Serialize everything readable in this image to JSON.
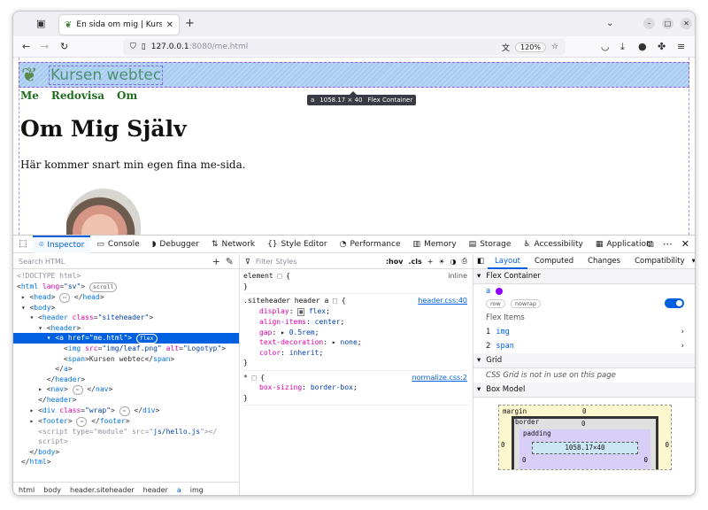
{
  "browser": {
    "tab_title": "En sida om mig | Kursen webtec",
    "url_host": "127.0.0.1",
    "url_rest": ":8080/me.html",
    "zoom": "120%"
  },
  "page": {
    "brand": "Kursen webtec",
    "nav": [
      "Me",
      "Redovisa",
      "Om"
    ],
    "heading": "Om Mig Själv",
    "lead": "Här kommer snart min egen fina me-sida.",
    "tooltip_tag": "a",
    "tooltip_size": "1058.17 × 40",
    "tooltip_kind": "Flex Container"
  },
  "devtools": {
    "tabs": [
      {
        "icon": "⌾",
        "label": "Inspector"
      },
      {
        "icon": "▭",
        "label": "Console"
      },
      {
        "icon": "◗",
        "label": "Debugger"
      },
      {
        "icon": "⇅",
        "label": "Network"
      },
      {
        "icon": "{}",
        "label": "Style Editor"
      },
      {
        "icon": "◔",
        "label": "Performance"
      },
      {
        "icon": "▥",
        "label": "Memory"
      },
      {
        "icon": "▤",
        "label": "Storage"
      },
      {
        "icon": "♿",
        "label": "Accessibility"
      },
      {
        "icon": "▦",
        "label": "Application"
      }
    ],
    "search_placeholder": "Search HTML",
    "filter_placeholder": "Filter Styles",
    "hov": ":hov",
    "cls": ".cls",
    "breadcrumbs": [
      "html",
      "body",
      "header.siteheader",
      "header",
      "a",
      "img"
    ],
    "layout_tabs": [
      "Layout",
      "Computed",
      "Changes",
      "Compatibility"
    ],
    "flex_container_title": "Flex Container",
    "flex_el": "a",
    "chip_row": "row",
    "chip_nowrap": "nowrap",
    "flex_items_title": "Flex Items",
    "flex_items": [
      {
        "n": "1",
        "name": "img"
      },
      {
        "n": "2",
        "name": "span"
      }
    ],
    "grid_title": "Grid",
    "grid_text": "CSS Grid is not in use on this page",
    "boxmodel_title": "Box Model",
    "bm_margin": "margin",
    "bm_border": "border",
    "bm_padding": "padding",
    "bm_content": "1058.17×40",
    "bm_zero": "0",
    "css": {
      "element_sel": "element",
      "element_src": "inline",
      "rule_sel": ".siteheader header a",
      "rule_src": "header.css:40",
      "props": [
        {
          "n": "display",
          "v": "flex"
        },
        {
          "n": "align-items",
          "v": "center"
        },
        {
          "n": "gap",
          "v": "0.5rem"
        },
        {
          "n": "text-decoration",
          "v": "none"
        },
        {
          "n": "color",
          "v": "inherit"
        }
      ],
      "univ_sel": "*",
      "univ_src": "normalize.css:2",
      "univ_prop": {
        "n": "box-sizing",
        "v": "border-box"
      }
    }
  }
}
